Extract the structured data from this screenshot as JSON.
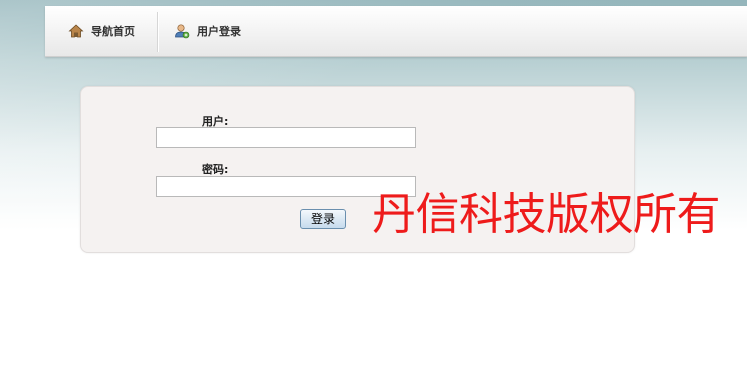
{
  "nav": {
    "items": [
      {
        "label": "导航首页",
        "icon": "home-icon"
      },
      {
        "label": "用户登录",
        "icon": "user-icon"
      }
    ]
  },
  "login_form": {
    "user_label": "用户:",
    "user_value": "",
    "password_label": "密码:",
    "password_value": "",
    "submit_label": "登录"
  },
  "copyright": "丹信科技版权所有",
  "colors": {
    "copyright_text": "#ee1b1b",
    "panel_background": "#f5f2f1",
    "button_border": "#6a8fae"
  }
}
